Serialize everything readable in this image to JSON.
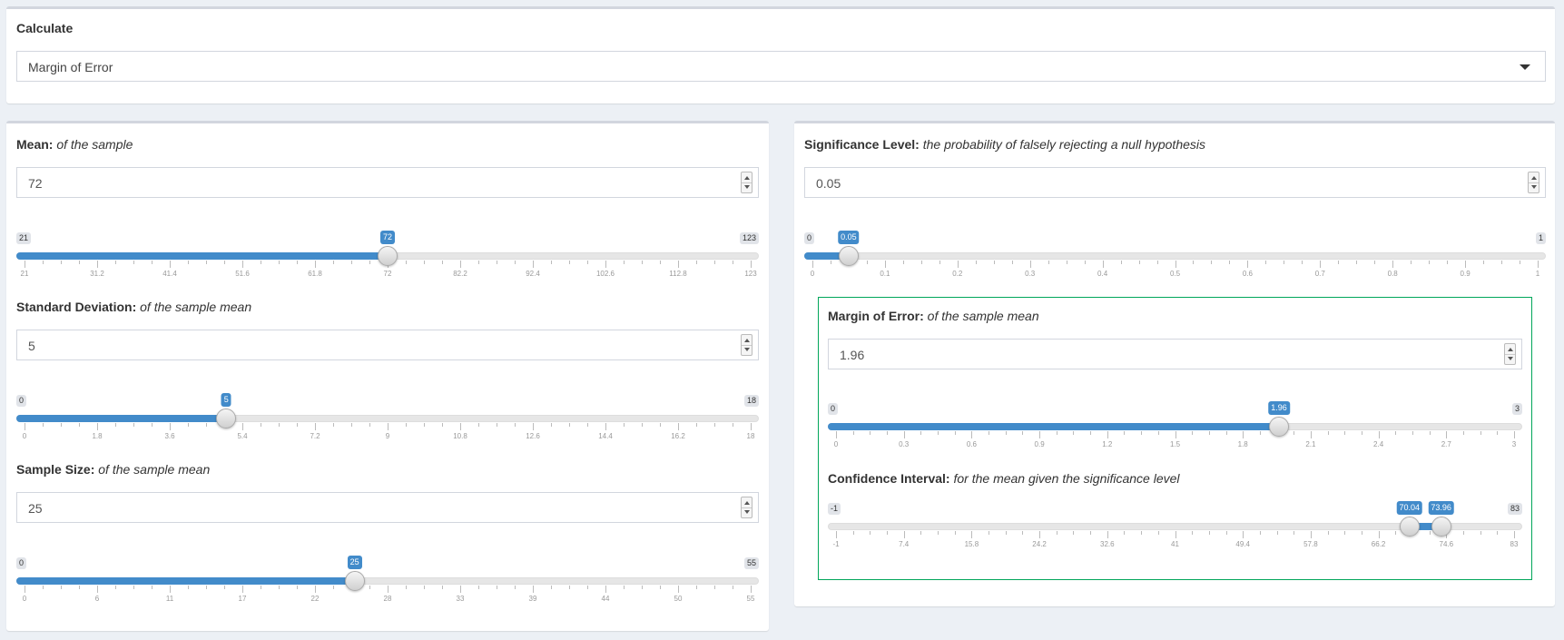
{
  "calculate": {
    "label": "Calculate",
    "selected": "Margin of Error"
  },
  "mean": {
    "label_bold": "Mean:",
    "label_italic": "of the sample",
    "value": "72",
    "slider": {
      "min": 21,
      "max": 123,
      "value": 72,
      "min_label": "21",
      "max_label": "123",
      "value_label": "72",
      "ticks": [
        "21",
        "31.2",
        "41.4",
        "51.6",
        "61.8",
        "72",
        "82.2",
        "92.4",
        "102.6",
        "112.8",
        "123"
      ]
    }
  },
  "sd": {
    "label_bold": "Standard Deviation:",
    "label_italic": "of the sample mean",
    "value": "5",
    "slider": {
      "min": 0,
      "max": 18,
      "value": 5,
      "min_label": "0",
      "max_label": "18",
      "value_label": "5",
      "ticks": [
        "0",
        "1.8",
        "3.6",
        "5.4",
        "7.2",
        "9",
        "10.8",
        "12.6",
        "14.4",
        "16.2",
        "18"
      ]
    }
  },
  "n": {
    "label_bold": "Sample Size:",
    "label_italic": "of the sample mean",
    "value": "25",
    "slider": {
      "min": 0,
      "max": 55,
      "value": 25,
      "min_label": "0",
      "max_label": "55",
      "value_label": "25",
      "ticks": [
        "0",
        "6",
        "11",
        "17",
        "22",
        "28",
        "33",
        "39",
        "44",
        "50",
        "55"
      ]
    }
  },
  "alpha": {
    "label_bold": "Significance Level:",
    "label_italic": "the probability of falsely rejecting a null hypothesis",
    "value": "0.05",
    "slider": {
      "min": 0,
      "max": 1,
      "value": 0.05,
      "min_label": "0",
      "max_label": "1",
      "value_label": "0.05",
      "ticks": [
        "0",
        "0.1",
        "0.2",
        "0.3",
        "0.4",
        "0.5",
        "0.6",
        "0.7",
        "0.8",
        "0.9",
        "1"
      ]
    }
  },
  "moe": {
    "label_bold": "Margin of Error:",
    "label_italic": "of the sample mean",
    "value": "1.96",
    "slider": {
      "min": 0,
      "max": 3,
      "value": 1.96,
      "min_label": "0",
      "max_label": "3",
      "value_label": "1.96",
      "ticks": [
        "0",
        "0.3",
        "0.6",
        "0.9",
        "1.2",
        "1.5",
        "1.8",
        "2.1",
        "2.4",
        "2.7",
        "3"
      ]
    }
  },
  "ci": {
    "label_bold": "Confidence Interval:",
    "label_italic": "for the mean given the significance level",
    "slider": {
      "min": -1,
      "max": 83,
      "low": 70.04,
      "high": 73.96,
      "min_label": "-1",
      "max_label": "83",
      "low_label": "70.04",
      "high_label": "73.96",
      "ticks": [
        "-1",
        "7.4",
        "15.8",
        "24.2",
        "32.6",
        "41",
        "49.4",
        "57.8",
        "66.2",
        "74.6",
        "83"
      ]
    }
  },
  "colors": {
    "accent": "#428bca",
    "box_border": "#00a65a",
    "background": "#ecf0f5"
  }
}
